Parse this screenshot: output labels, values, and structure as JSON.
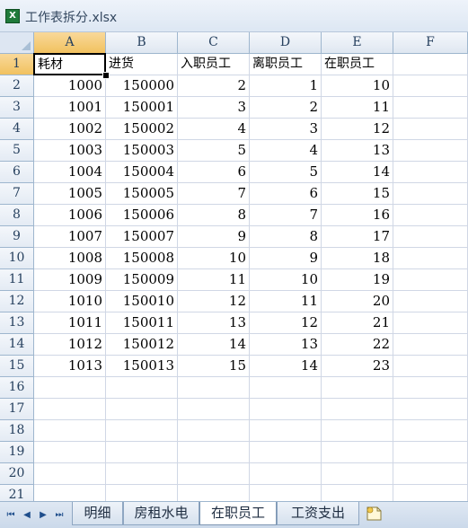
{
  "window": {
    "title": "工作表拆分.xlsx"
  },
  "columns": [
    "A",
    "B",
    "C",
    "D",
    "E",
    "F"
  ],
  "selected_column": "A",
  "selected_row": "1",
  "rows": [
    {
      "num": "1",
      "cells": [
        "耗材",
        "进货",
        "入职员工",
        "离职员工",
        "在职员工",
        ""
      ]
    },
    {
      "num": "2",
      "cells": [
        "1000",
        "150000",
        "2",
        "1",
        "10",
        ""
      ]
    },
    {
      "num": "3",
      "cells": [
        "1001",
        "150001",
        "3",
        "2",
        "11",
        ""
      ]
    },
    {
      "num": "4",
      "cells": [
        "1002",
        "150002",
        "4",
        "3",
        "12",
        ""
      ]
    },
    {
      "num": "5",
      "cells": [
        "1003",
        "150003",
        "5",
        "4",
        "13",
        ""
      ]
    },
    {
      "num": "6",
      "cells": [
        "1004",
        "150004",
        "6",
        "5",
        "14",
        ""
      ]
    },
    {
      "num": "7",
      "cells": [
        "1005",
        "150005",
        "7",
        "6",
        "15",
        ""
      ]
    },
    {
      "num": "8",
      "cells": [
        "1006",
        "150006",
        "8",
        "7",
        "16",
        ""
      ]
    },
    {
      "num": "9",
      "cells": [
        "1007",
        "150007",
        "9",
        "8",
        "17",
        ""
      ]
    },
    {
      "num": "10",
      "cells": [
        "1008",
        "150008",
        "10",
        "9",
        "18",
        ""
      ]
    },
    {
      "num": "11",
      "cells": [
        "1009",
        "150009",
        "11",
        "10",
        "19",
        ""
      ]
    },
    {
      "num": "12",
      "cells": [
        "1010",
        "150010",
        "12",
        "11",
        "20",
        ""
      ]
    },
    {
      "num": "13",
      "cells": [
        "1011",
        "150011",
        "13",
        "12",
        "21",
        ""
      ]
    },
    {
      "num": "14",
      "cells": [
        "1012",
        "150012",
        "14",
        "13",
        "22",
        ""
      ]
    },
    {
      "num": "15",
      "cells": [
        "1013",
        "150013",
        "15",
        "14",
        "23",
        ""
      ]
    },
    {
      "num": "16",
      "cells": [
        "",
        "",
        "",
        "",
        "",
        ""
      ]
    },
    {
      "num": "17",
      "cells": [
        "",
        "",
        "",
        "",
        "",
        ""
      ]
    },
    {
      "num": "18",
      "cells": [
        "",
        "",
        "",
        "",
        "",
        ""
      ]
    },
    {
      "num": "19",
      "cells": [
        "",
        "",
        "",
        "",
        "",
        ""
      ]
    },
    {
      "num": "20",
      "cells": [
        "",
        "",
        "",
        "",
        "",
        ""
      ]
    },
    {
      "num": "21",
      "cells": [
        "",
        "",
        "",
        "",
        "",
        ""
      ]
    }
  ],
  "sheet_tabs": [
    "明细",
    "房租水电",
    "在职员工",
    "工资支出"
  ],
  "active_sheet": "在职员工",
  "icons": {
    "excel": "excel-file-icon",
    "nav_first": "first-sheet-icon",
    "nav_prev": "prev-sheet-icon",
    "nav_next": "next-sheet-icon",
    "nav_last": "last-sheet-icon",
    "new_sheet": "insert-sheet-icon"
  }
}
